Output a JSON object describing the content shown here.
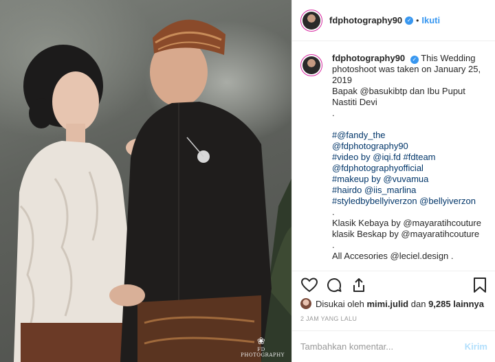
{
  "post": {
    "watermark": "FD PHOTOGRAPHY"
  },
  "header": {
    "username": "fdphotography90",
    "separator": "•",
    "follow_label": "Ikuti"
  },
  "caption": {
    "username": "fdphotography90",
    "lines": [
      "This Wedding",
      "photoshoot was taken on January 25,",
      "2019",
      "Bapak @basukibtp dan Ibu Puput",
      "Nastiti Devi",
      ".",
      "",
      "#@fandy_the",
      "@fdphotography90",
      "#video by @iqi.fd #fdteam",
      "@fdphotographyofficial",
      "#makeup by @vuvamua",
      "#hairdo @iis_marlina",
      "#styledbybellyiverzon @bellyiverzon",
      ".",
      "Klasik Kebaya by @mayaratihcouture",
      "klasik Beskap by @mayaratihcouture",
      ".",
      "All Accesories @leciel.design ."
    ]
  },
  "actions": {
    "like_icon": "heart-icon",
    "comment_icon": "comment-icon",
    "share_icon": "share-icon",
    "save_icon": "bookmark-icon"
  },
  "likes": {
    "prefix": "Disukai oleh",
    "user": "mimi.julid",
    "connector": "dan",
    "others": "9,285 lainnya"
  },
  "timestamp": "2 JAM YANG LALU",
  "comment": {
    "placeholder": "Tambahkan komentar...",
    "post_label": "Kirim"
  },
  "colors": {
    "link": "#003569",
    "accent": "#3897f0",
    "post_disabled": "#b2dffc",
    "muted": "#999999"
  }
}
